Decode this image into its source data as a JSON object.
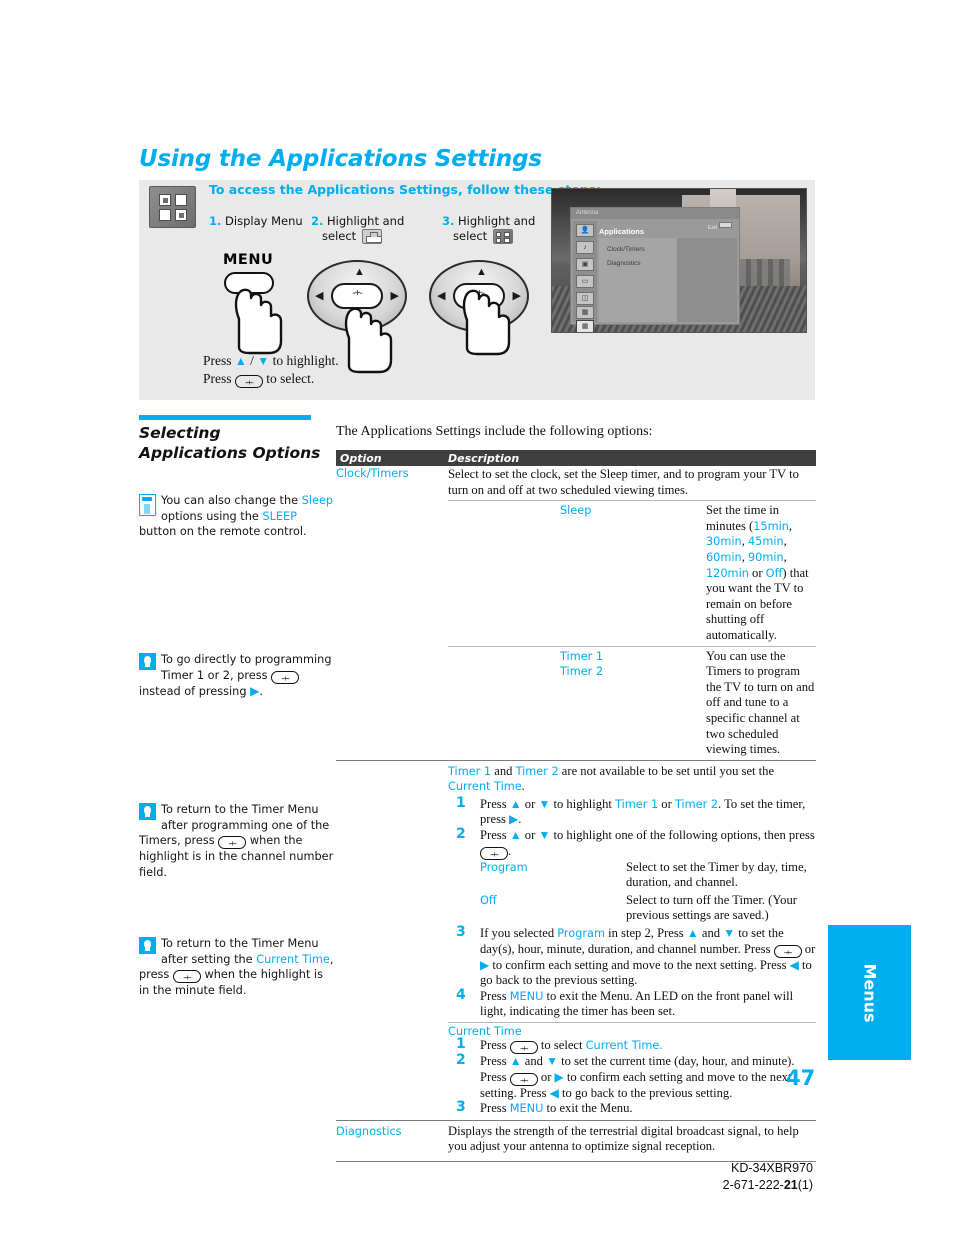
{
  "title": "Using the Applications Settings",
  "access_box": {
    "heading": "To access the Applications Settings, follow these steps:",
    "steps": [
      {
        "num": "1.",
        "line1": "Display Menu",
        "line2": ""
      },
      {
        "num": "2.",
        "line1": "Highlight and",
        "line2": "select"
      },
      {
        "num": "3.",
        "line1": "Highlight and",
        "line2": "select"
      }
    ],
    "menu_button_label": "MENU",
    "press_highlight": "to highlight.",
    "press_select": "to select.",
    "press_word": "Press"
  },
  "tv_screen": {
    "antenna_label": "Antenna",
    "menu_title": "Applications",
    "exit_label": "Exit",
    "items": [
      "Clock/Timers",
      "Diagnostics"
    ]
  },
  "sidebar": {
    "heading": "Selecting Applications Options",
    "notes": [
      {
        "icon": "remote-icon",
        "parts": [
          {
            "t": "You can also change the ",
            "c": "black"
          },
          {
            "t": "Sleep",
            "c": "cyan"
          },
          {
            "t": " options using the ",
            "c": "black"
          },
          {
            "t": "SLEEP",
            "c": "cyan"
          },
          {
            "t": " button on the remote control.",
            "c": "black"
          }
        ]
      },
      {
        "icon": "tip-icon",
        "parts": [
          {
            "t": "To go directly to programming Timer 1 or 2, press ",
            "c": "black"
          },
          {
            "t": "ENTER",
            "c": "button"
          },
          {
            "t": " instead of pressing ",
            "c": "black"
          },
          {
            "t": "RIGHT",
            "c": "arrow"
          },
          {
            "t": ".",
            "c": "black"
          }
        ]
      },
      {
        "icon": "tip-icon",
        "parts": [
          {
            "t": "To return to the Timer Menu after programming one of the Timers, press ",
            "c": "black"
          },
          {
            "t": "ENTER",
            "c": "button"
          },
          {
            "t": " when the highlight is in the channel number field.",
            "c": "black"
          }
        ]
      },
      {
        "icon": "tip-icon",
        "parts": [
          {
            "t": "To return to the Timer Menu after setting the ",
            "c": "black"
          },
          {
            "t": "Current Time",
            "c": "cyan"
          },
          {
            "t": ", press ",
            "c": "black"
          },
          {
            "t": "ENTER",
            "c": "button"
          },
          {
            "t": " when the highlight is in the minute field.",
            "c": "black"
          }
        ]
      }
    ]
  },
  "main": {
    "lead": "The Applications Settings include the following options:",
    "table_headers": {
      "option": "Option",
      "description": "Description"
    },
    "clock_timers": {
      "option": "Clock/Timers",
      "description": "Select to set the clock, set the Sleep timer, and to program your TV to turn on and off at two scheduled viewing times."
    },
    "sleep": {
      "option": "Sleep",
      "desc_pre": "Set the time in minutes (",
      "values": [
        "15min",
        "30min",
        "45min",
        "60min",
        "90min",
        "120min"
      ],
      "or": " or ",
      "off": "Off",
      "desc_post": ") that you want the TV to remain on before shutting off automatically."
    },
    "timers": {
      "option_1": "Timer 1",
      "option_2": "Timer 2",
      "description": "You can use the Timers to program the TV to turn on and off and tune to a specific channel at two scheduled viewing times."
    },
    "timer_procedure": {
      "intro_a": "Timer 1",
      "intro_and": " and ",
      "intro_b": "Timer 2",
      "intro_c": " are not available to be set until you set the ",
      "intro_d": "Current Time",
      "intro_e": ".",
      "steps": [
        {
          "num": "1",
          "text_a": "Press ",
          "text_b": " or ",
          "text_c": " to highlight ",
          "ui_a": "Timer 1",
          "text_d": " or ",
          "ui_b": "Timer 2",
          "text_e": ". To set the timer, press ",
          "text_f": "."
        },
        {
          "num": "2",
          "text_a": "Press ",
          "text_b": " or ",
          "text_c": " to highlight one of the following options, then press ",
          "text_d": "."
        }
      ],
      "sub_options": [
        {
          "label": "Program",
          "text": "Select to set the Timer by day, time, duration, and channel."
        },
        {
          "label": "Off",
          "text": "Select to turn off the Timer. (Your previous settings are saved.)"
        }
      ],
      "step3": {
        "num": "3",
        "a": "If you selected ",
        "ui": "Program",
        "b": " in step 2, Press ",
        "c": " and ",
        "d": " to set the day(s), hour, minute, duration, and channel number. Press ",
        "e": " or ",
        "f": " to confirm each setting and move to the next setting. Press ",
        "g": " to go back to the previous setting."
      },
      "step4": {
        "num": "4",
        "a": "Press ",
        "ui": "MENU",
        "b": " to exit the Menu. An LED on the front panel will light, indicating the timer has been set."
      }
    },
    "current_time": {
      "heading": "Current Time",
      "step1": {
        "num": "1",
        "a": "Press ",
        "b": " to select ",
        "ui": "Current Time.",
        "c": ""
      },
      "step2": {
        "num": "2",
        "a": "Press ",
        "b": " and ",
        "c": " to set the current time (day, hour, and minute). Press ",
        "d": " or ",
        "e": " to confirm each setting and move to the next setting. Press ",
        "f": " to go back to the previous setting."
      },
      "step3": {
        "num": "3",
        "a": "Press ",
        "ui": "MENU",
        "b": " to exit the Menu."
      }
    },
    "diagnostics": {
      "option": "Diagnostics",
      "description": "Displays the strength of the terrestrial digital broadcast signal, to help you adjust your antenna to optimize signal reception."
    }
  },
  "page_number": "47",
  "side_tab_label": "Menus",
  "footer": {
    "model": "KD-34XBR970",
    "doc_a": "2-671-222-",
    "doc_b": "21",
    "doc_c": "(1)"
  },
  "colors": {
    "accent": "#00AEEF",
    "header_bar": "#3f3f3f",
    "box_bg": "#e9e9e9"
  }
}
